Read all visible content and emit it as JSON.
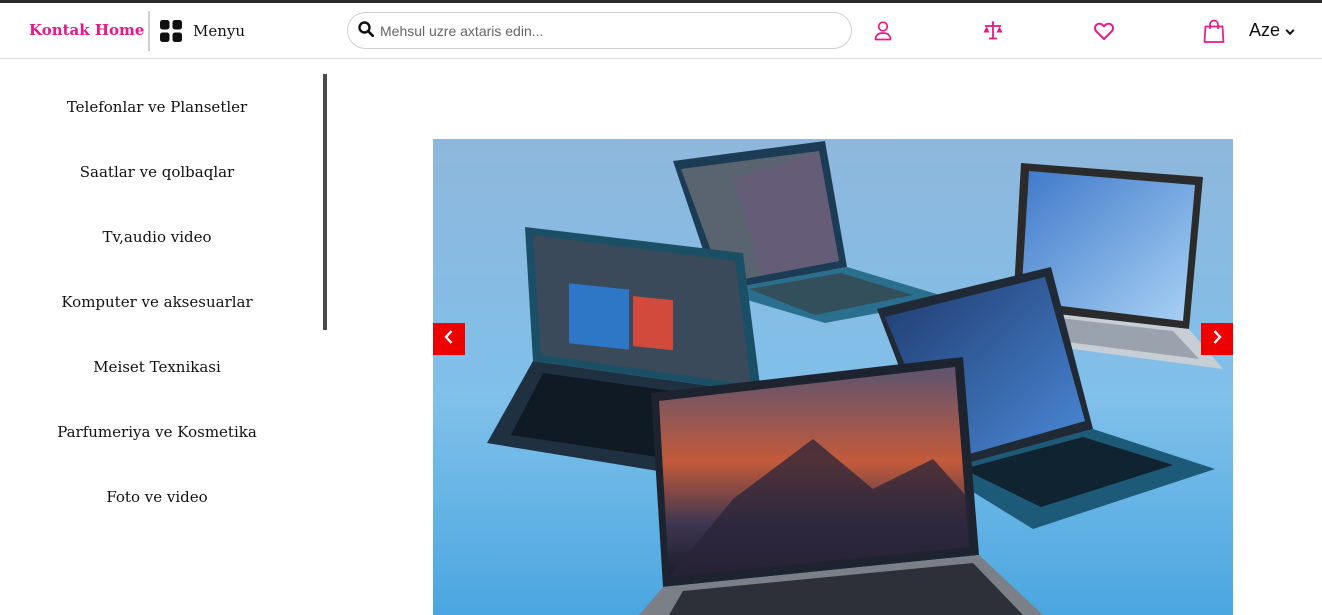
{
  "header": {
    "brand": "Kontak Home",
    "menu_label": "Menyu",
    "menu_icon": "grid-icon",
    "search": {
      "placeholder": "Mehsul uzre axtaris edin...",
      "value": ""
    },
    "icons": [
      "user-icon",
      "scales-icon",
      "heart-icon",
      "bag-icon"
    ],
    "language": "Aze"
  },
  "sidebar": {
    "categories": [
      "Telefonlar ve Plansetler",
      "Saatlar ve qolbaqlar",
      "Tv,audio video",
      "Komputer ve aksesuarlar",
      "Meiset Texnikasi",
      "Parfumeriya ve Kosmetika",
      "Foto ve video"
    ]
  },
  "banner": {
    "image": "laptops-photo",
    "prev_icon": "chevron-left-icon",
    "next_icon": "chevron-right-icon"
  },
  "colors": {
    "brand": "#e8178a",
    "accent_icons": "#e8178a",
    "slider_arrows": "#ee0000",
    "text": "#111111"
  }
}
